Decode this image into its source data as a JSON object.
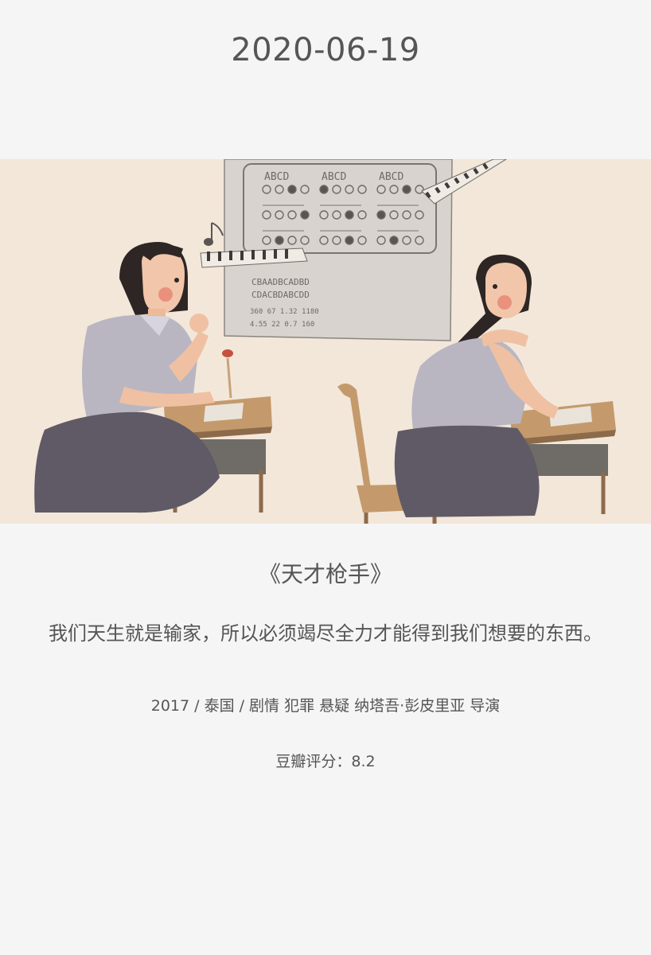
{
  "date": "2020-06-19",
  "movie": {
    "title": "《天才枪手》",
    "quote": "我们天生就是输家，所以必须竭尽全力才能得到我们想要的东西。",
    "meta": "2017 / 泰国 / 剧情 犯罪 悬疑 纳塔吾·彭皮里亚 导演",
    "rating": "豆瓣评分：8.2"
  },
  "illustration": {
    "answer_letters": [
      "ABCD",
      "ABCD",
      "ABCD"
    ],
    "code_lines": [
      "CBAADBCADBD",
      "CDACBDABCDD"
    ],
    "number_lines": [
      "360 67 1.32 1180",
      "4.55 22 0.7 160"
    ]
  },
  "colors": {
    "background": "#f5f5f5",
    "text": "#555555",
    "illustration_bg": "#f3e7da"
  }
}
